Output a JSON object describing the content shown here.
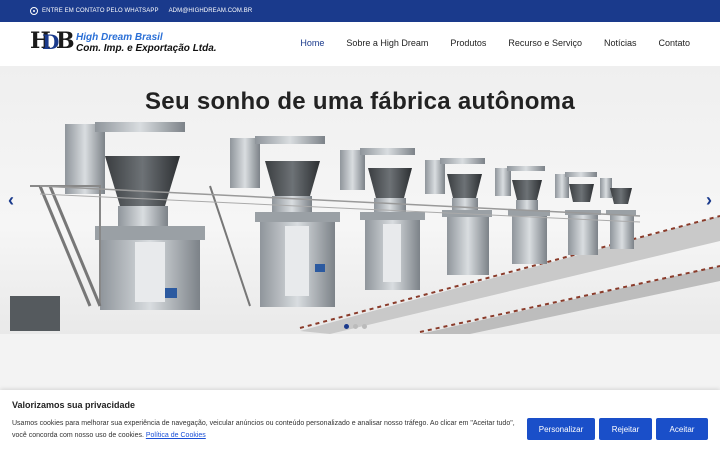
{
  "topbar": {
    "whatsapp_label": "ENTRE EM CONTATO PELO WHATSAPP",
    "email": "ADM@HIGHDREAM.COM.BR"
  },
  "logo": {
    "mark_h": "H",
    "mark_d": "D",
    "mark_b": "B",
    "line1": "High Dream Brasil",
    "line2": "Com. Imp. e Exportação Ltda."
  },
  "nav": {
    "items": [
      {
        "label": "Home"
      },
      {
        "label": "Sobre a High Dream"
      },
      {
        "label": "Produtos"
      },
      {
        "label": "Recurso e Serviço"
      },
      {
        "label": "Notícias"
      },
      {
        "label": "Contato"
      }
    ]
  },
  "hero": {
    "title": "Seu sonho de uma fábrica autônoma",
    "prev_arrow": "‹",
    "next_arrow": "›"
  },
  "cookie": {
    "title": "Valorizamos sua privacidade",
    "text": "Usamos cookies para melhorar sua experiência de navegação, veicular anúncios ou conteúdo personalizado e analisar nosso tráfego. Ao clicar em \"Aceitar tudo\", você concorda com nosso uso de cookies.",
    "policy_link": "Política de Cookies",
    "customize_label": "Personalizar",
    "reject_label": "Rejeitar",
    "accept_label": "Aceitar"
  },
  "colors": {
    "brand_blue": "#1a3a8c",
    "button_blue": "#1a4fc9",
    "logo_blue": "#2a6fd6"
  }
}
